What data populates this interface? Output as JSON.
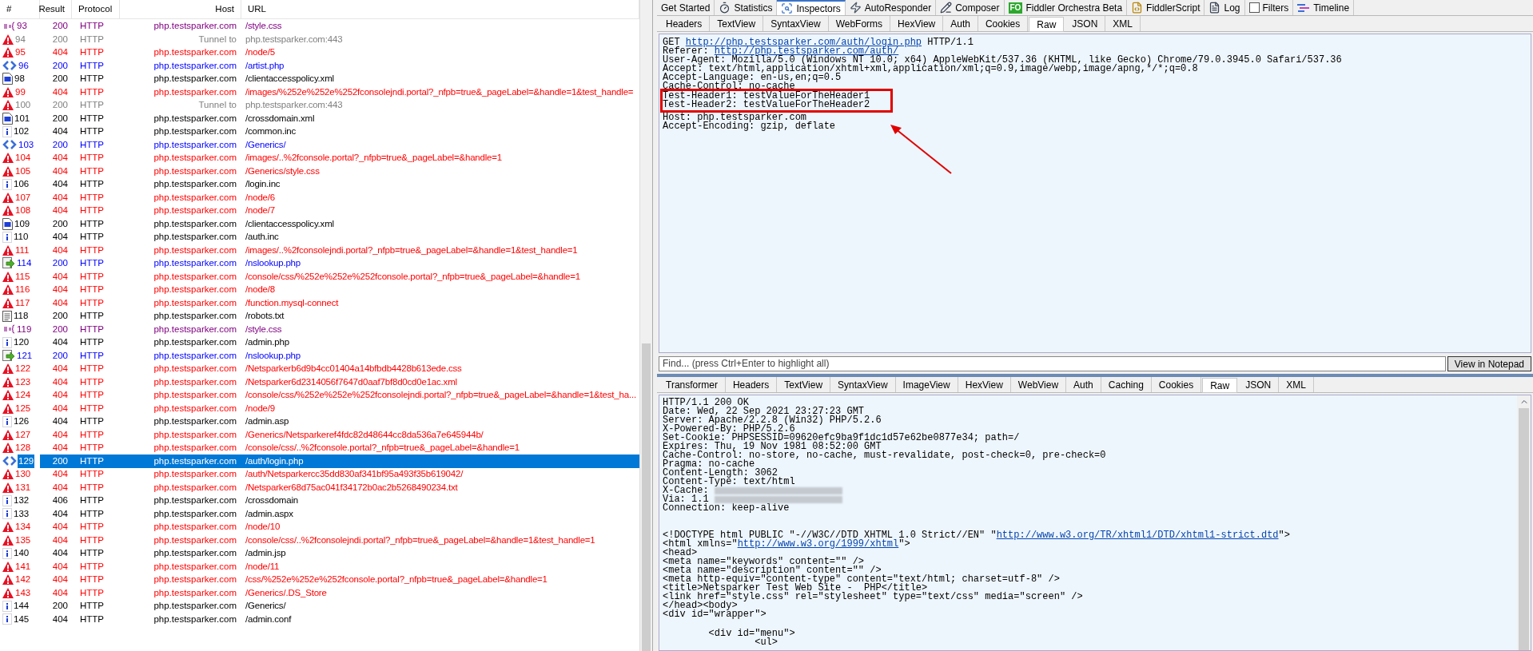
{
  "session_list": {
    "columns": [
      "#",
      "Result",
      "Protocol",
      "Host",
      "URL"
    ],
    "rows": [
      {
        "kind": "css",
        "id": "93",
        "result": "200",
        "protocol": "HTTP",
        "host": "php.testsparker.com",
        "url": "/style.css",
        "selected": false
      },
      {
        "kind": "tunnel",
        "id": "94",
        "result": "200",
        "protocol": "HTTP",
        "host": "Tunnel to",
        "url": "php.testsparker.com:443",
        "selected": false
      },
      {
        "kind": "warning",
        "id": "95",
        "result": "404",
        "protocol": "HTTP",
        "host": "php.testsparker.com",
        "url": "/node/5",
        "selected": false
      },
      {
        "kind": "script",
        "id": "96",
        "result": "200",
        "protocol": "HTTP",
        "host": "php.testsparker.com",
        "url": "/artist.php",
        "selected": false
      },
      {
        "kind": "xml",
        "id": "98",
        "result": "200",
        "protocol": "HTTP",
        "host": "php.testsparker.com",
        "url": "/clientaccesspolicy.xml",
        "selected": false
      },
      {
        "kind": "warning",
        "id": "99",
        "result": "404",
        "protocol": "HTTP",
        "host": "php.testsparker.com",
        "url": "/images/%252e%252e%252fconsolejndi.portal?_nfpb=true&_pageLabel=&handle=1&test_handle=",
        "selected": false
      },
      {
        "kind": "tunnel",
        "id": "100",
        "result": "200",
        "protocol": "HTTP",
        "host": "Tunnel to",
        "url": "php.testsparker.com:443",
        "selected": false
      },
      {
        "kind": "xml",
        "id": "101",
        "result": "200",
        "protocol": "HTTP",
        "host": "php.testsparker.com",
        "url": "/crossdomain.xml",
        "selected": false
      },
      {
        "kind": "info",
        "id": "102",
        "result": "404",
        "protocol": "HTTP",
        "host": "php.testsparker.com",
        "url": "/common.inc",
        "selected": false
      },
      {
        "kind": "script",
        "id": "103",
        "result": "200",
        "protocol": "HTTP",
        "host": "php.testsparker.com",
        "url": "/Generics/",
        "selected": false
      },
      {
        "kind": "warning",
        "id": "104",
        "result": "404",
        "protocol": "HTTP",
        "host": "php.testsparker.com",
        "url": "/images/..%2fconsole.portal?_nfpb=true&_pageLabel=&handle=1",
        "selected": false
      },
      {
        "kind": "warning",
        "id": "105",
        "result": "404",
        "protocol": "HTTP",
        "host": "php.testsparker.com",
        "url": "/Generics/style.css",
        "selected": false
      },
      {
        "kind": "info",
        "id": "106",
        "result": "404",
        "protocol": "HTTP",
        "host": "php.testsparker.com",
        "url": "/login.inc",
        "selected": false
      },
      {
        "kind": "warning",
        "id": "107",
        "result": "404",
        "protocol": "HTTP",
        "host": "php.testsparker.com",
        "url": "/node/6",
        "selected": false
      },
      {
        "kind": "warning",
        "id": "108",
        "result": "404",
        "protocol": "HTTP",
        "host": "php.testsparker.com",
        "url": "/node/7",
        "selected": false
      },
      {
        "kind": "xml",
        "id": "109",
        "result": "200",
        "protocol": "HTTP",
        "host": "php.testsparker.com",
        "url": "/clientaccesspolicy.xml",
        "selected": false
      },
      {
        "kind": "info",
        "id": "110",
        "result": "404",
        "protocol": "HTTP",
        "host": "php.testsparker.com",
        "url": "/auth.inc",
        "selected": false
      },
      {
        "kind": "warning",
        "id": "111",
        "result": "404",
        "protocol": "HTTP",
        "host": "php.testsparker.com",
        "url": "/images/..%2fconsolejndi.portal?_nfpb=true&_pageLabel=&handle=1&test_handle=1",
        "selected": false
      },
      {
        "kind": "forward",
        "id": "114",
        "result": "200",
        "protocol": "HTTP",
        "host": "php.testsparker.com",
        "url": "/nslookup.php",
        "selected": false
      },
      {
        "kind": "warning",
        "id": "115",
        "result": "404",
        "protocol": "HTTP",
        "host": "php.testsparker.com",
        "url": "/console/css/%252e%252e%252fconsole.portal?_nfpb=true&_pageLabel=&handle=1",
        "selected": false
      },
      {
        "kind": "warning",
        "id": "116",
        "result": "404",
        "protocol": "HTTP",
        "host": "php.testsparker.com",
        "url": "/node/8",
        "selected": false
      },
      {
        "kind": "warning",
        "id": "117",
        "result": "404",
        "protocol": "HTTP",
        "host": "php.testsparker.com",
        "url": "/function.mysql-connect",
        "selected": false
      },
      {
        "kind": "text",
        "id": "118",
        "result": "200",
        "protocol": "HTTP",
        "host": "php.testsparker.com",
        "url": "/robots.txt",
        "selected": false
      },
      {
        "kind": "css",
        "id": "119",
        "result": "200",
        "protocol": "HTTP",
        "host": "php.testsparker.com",
        "url": "/style.css",
        "selected": false
      },
      {
        "kind": "info",
        "id": "120",
        "result": "404",
        "protocol": "HTTP",
        "host": "php.testsparker.com",
        "url": "/admin.php",
        "selected": false
      },
      {
        "kind": "forward",
        "id": "121",
        "result": "200",
        "protocol": "HTTP",
        "host": "php.testsparker.com",
        "url": "/nslookup.php",
        "selected": false
      },
      {
        "kind": "warning",
        "id": "122",
        "result": "404",
        "protocol": "HTTP",
        "host": "php.testsparker.com",
        "url": "/Netsparkerb6d9b4cc01404a14bfbdb4428b613ede.css",
        "selected": false
      },
      {
        "kind": "warning",
        "id": "123",
        "result": "404",
        "protocol": "HTTP",
        "host": "php.testsparker.com",
        "url": "/Netsparker6d2314056f7647d0aaf7bf8d0cd0e1ac.xml",
        "selected": false
      },
      {
        "kind": "warning",
        "id": "124",
        "result": "404",
        "protocol": "HTTP",
        "host": "php.testsparker.com",
        "url": "/console/css/%252e%252e%252fconsolejndi.portal?_nfpb=true&_pageLabel=&handle=1&test_ha...",
        "selected": false
      },
      {
        "kind": "warning",
        "id": "125",
        "result": "404",
        "protocol": "HTTP",
        "host": "php.testsparker.com",
        "url": "/node/9",
        "selected": false
      },
      {
        "kind": "info",
        "id": "126",
        "result": "404",
        "protocol": "HTTP",
        "host": "php.testsparker.com",
        "url": "/admin.asp",
        "selected": false
      },
      {
        "kind": "warning",
        "id": "127",
        "result": "404",
        "protocol": "HTTP",
        "host": "php.testsparker.com",
        "url": "/Generics/Netsparkeref4fdc82d48644cc8da536a7e645944b/",
        "selected": false
      },
      {
        "kind": "warning",
        "id": "128",
        "result": "404",
        "protocol": "HTTP",
        "host": "php.testsparker.com",
        "url": "/console/css/..%2fconsole.portal?_nfpb=true&_pageLabel=&handle=1",
        "selected": false
      },
      {
        "kind": "script",
        "id": "129",
        "result": "200",
        "protocol": "HTTP",
        "host": "php.testsparker.com",
        "url": "/auth/login.php",
        "selected": true
      },
      {
        "kind": "warning",
        "id": "130",
        "result": "404",
        "protocol": "HTTP",
        "host": "php.testsparker.com",
        "url": "/auth/Netsparkercc35dd830af341bf95a493f35b619042/",
        "selected": false
      },
      {
        "kind": "warning",
        "id": "131",
        "result": "404",
        "protocol": "HTTP",
        "host": "php.testsparker.com",
        "url": "/Netsparker68d75ac041f34172b0ac2b5268490234.txt",
        "selected": false
      },
      {
        "kind": "info",
        "id": "132",
        "result": "406",
        "protocol": "HTTP",
        "host": "php.testsparker.com",
        "url": "/crossdomain",
        "selected": false
      },
      {
        "kind": "info",
        "id": "133",
        "result": "404",
        "protocol": "HTTP",
        "host": "php.testsparker.com",
        "url": "/admin.aspx",
        "selected": false
      },
      {
        "kind": "warning",
        "id": "134",
        "result": "404",
        "protocol": "HTTP",
        "host": "php.testsparker.com",
        "url": "/node/10",
        "selected": false
      },
      {
        "kind": "warning",
        "id": "135",
        "result": "404",
        "protocol": "HTTP",
        "host": "php.testsparker.com",
        "url": "/console/css/..%2fconsolejndi.portal?_nfpb=true&_pageLabel=&handle=1&test_handle=1",
        "selected": false
      },
      {
        "kind": "info",
        "id": "140",
        "result": "404",
        "protocol": "HTTP",
        "host": "php.testsparker.com",
        "url": "/admin.jsp",
        "selected": false
      },
      {
        "kind": "warning",
        "id": "141",
        "result": "404",
        "protocol": "HTTP",
        "host": "php.testsparker.com",
        "url": "/node/11",
        "selected": false
      },
      {
        "kind": "warning",
        "id": "142",
        "result": "404",
        "protocol": "HTTP",
        "host": "php.testsparker.com",
        "url": "/css/%252e%252e%252fconsole.portal?_nfpb=true&_pageLabel=&handle=1",
        "selected": false
      },
      {
        "kind": "warning",
        "id": "143",
        "result": "404",
        "protocol": "HTTP",
        "host": "php.testsparker.com",
        "url": "/Generics/.DS_Store",
        "selected": false
      },
      {
        "kind": "info",
        "id": "144",
        "result": "200",
        "protocol": "HTTP",
        "host": "php.testsparker.com",
        "url": "/Generics/",
        "selected": false
      },
      {
        "kind": "info",
        "id": "145",
        "result": "404",
        "protocol": "HTTP",
        "host": "php.testsparker.com",
        "url": "/admin.conf",
        "selected": false
      }
    ]
  },
  "main_tabs": [
    {
      "kind": "plain",
      "label": "Get Started",
      "selected": false
    },
    {
      "kind": "stopwatch",
      "label": "Statistics",
      "selected": false
    },
    {
      "kind": "inspect",
      "label": "Inspectors",
      "selected": true
    },
    {
      "kind": "bolt",
      "label": "AutoResponder",
      "selected": false
    },
    {
      "kind": "pencil",
      "label": "Composer",
      "selected": false
    },
    {
      "kind": "badge",
      "badge": "FO",
      "label": "Fiddler Orchestra Beta",
      "selected": false
    },
    {
      "kind": "script",
      "label": "FiddlerScript",
      "selected": false
    },
    {
      "kind": "log",
      "label": "Log",
      "selected": false
    },
    {
      "kind": "checkbox",
      "label": "Filters",
      "checked": false,
      "selected": false
    },
    {
      "kind": "timeline",
      "label": "Timeline",
      "selected": false
    }
  ],
  "request": {
    "tabs": [
      {
        "label": "Headers",
        "selected": false
      },
      {
        "label": "TextView",
        "selected": false
      },
      {
        "label": "SyntaxView",
        "selected": false
      },
      {
        "label": "WebForms",
        "selected": false
      },
      {
        "label": "HexView",
        "selected": false
      },
      {
        "label": "Auth",
        "selected": false
      },
      {
        "label": "Cookies",
        "selected": false
      },
      {
        "label": "Raw",
        "selected": true
      },
      {
        "label": "JSON",
        "selected": false
      },
      {
        "label": "XML",
        "selected": false
      }
    ],
    "lines_before": [
      {
        "text": "GET ",
        "link": "http://php.testsparker.com/auth/login.php",
        "after": " HTTP/1.1"
      },
      {
        "text": "Referer: ",
        "link": "http://php.testsparker.com/auth/"
      },
      {
        "text": "User-Agent: Mozilla/5.0 (Windows NT 10.0; x64) AppleWebKit/537.36 (KHTML, like Gecko) Chrome/79.0.3945.0 Safari/537.36"
      },
      {
        "text": "Accept: text/html,application/xhtml+xml,application/xml;q=0.9,image/webp,image/apng,*/*;q=0.8"
      },
      {
        "text": "Accept-Language: en-us,en;q=0.5"
      },
      {
        "text": "Cache-Control: no-cache"
      }
    ],
    "highlighted_lines": [
      {
        "text": "Test-Header1: testValueForTheHeader1"
      },
      {
        "text": "Test-Header2: testValueForTheHeader2"
      }
    ],
    "lines_after": [
      {
        "text": "Host: php.testsparker.com"
      },
      {
        "text": "Accept-Encoding: gzip, deflate"
      }
    ],
    "find": {
      "placeholder": "Find... (press Ctrl+Enter to highlight all)"
    },
    "view_button": "View in Notepad"
  },
  "response": {
    "tabs": [
      {
        "label": "Transformer",
        "selected": false
      },
      {
        "label": "Headers",
        "selected": false
      },
      {
        "label": "TextView",
        "selected": false
      },
      {
        "label": "SyntaxView",
        "selected": false
      },
      {
        "label": "ImageView",
        "selected": false
      },
      {
        "label": "HexView",
        "selected": false
      },
      {
        "label": "WebView",
        "selected": false
      },
      {
        "label": "Auth",
        "selected": false
      },
      {
        "label": "Caching",
        "selected": false
      },
      {
        "label": "Cookies",
        "selected": false
      },
      {
        "label": "Raw",
        "selected": true
      },
      {
        "label": "JSON",
        "selected": false
      },
      {
        "label": "XML",
        "selected": false
      }
    ],
    "header_lines": [
      {
        "text": "HTTP/1.1 200 OK",
        "redacted": false
      },
      {
        "text": "Date: Wed, 22 Sep 2021 23:27:23 GMT",
        "redacted": false
      },
      {
        "text": "Server: Apache/2.2.8 (Win32) PHP/5.2.6",
        "redacted": false
      },
      {
        "text": "X-Powered-By: PHP/5.2.6",
        "redacted": false
      },
      {
        "text": "Set-Cookie: PHPSESSID=09620efc9ba9f1dc1d57e62be0877e34; path=/",
        "redacted": false
      },
      {
        "text": "Expires: Thu, 19 Nov 1981 08:52:00 GMT",
        "redacted": false
      },
      {
        "text": "Cache-Control: no-store, no-cache, must-revalidate, post-check=0, pre-check=0",
        "redacted": false
      },
      {
        "text": "Pragma: no-cache",
        "redacted": false
      },
      {
        "text": "Content-Length: 3062",
        "redacted": false
      },
      {
        "text": "Content-Type: text/html",
        "redacted": false
      },
      {
        "text": "X-Cache:",
        "redacted": true
      },
      {
        "text": "Via: 1.1",
        "redacted": true
      },
      {
        "text": "Connection: keep-alive",
        "redacted": false
      }
    ],
    "body_lines": [
      {
        "text": "<!DOCTYPE html PUBLIC \"-//W3C//DTD XHTML 1.0 Strict//EN\" \"",
        "link": "http://www.w3.org/TR/xhtml1/DTD/xhtml1-strict.dtd",
        "after": "\">"
      },
      {
        "text": "<html xmlns=\"",
        "link": "http://www.w3.org/1999/xhtml",
        "after": "\">"
      },
      {
        "text": "<head>"
      },
      {
        "text": "<meta name=\"keywords\" content=\"\" />"
      },
      {
        "text": "<meta name=\"description\" content=\"\" />"
      },
      {
        "text": "<meta http-equiv=\"content-type\" content=\"text/html; charset=utf-8\" />"
      },
      {
        "text": "<title>Netsparker Test Web Site -  PHP</title>"
      },
      {
        "text": "<link href=\"style.css\" rel=\"stylesheet\" type=\"text/css\" media=\"screen\" />"
      },
      {
        "text": "</head><body>"
      },
      {
        "text": "<div id=\"wrapper\">"
      }
    ],
    "menu_lines": [
      {
        "text": "        <div id=\"menu\">"
      },
      {
        "text": "                <ul>"
      }
    ]
  }
}
